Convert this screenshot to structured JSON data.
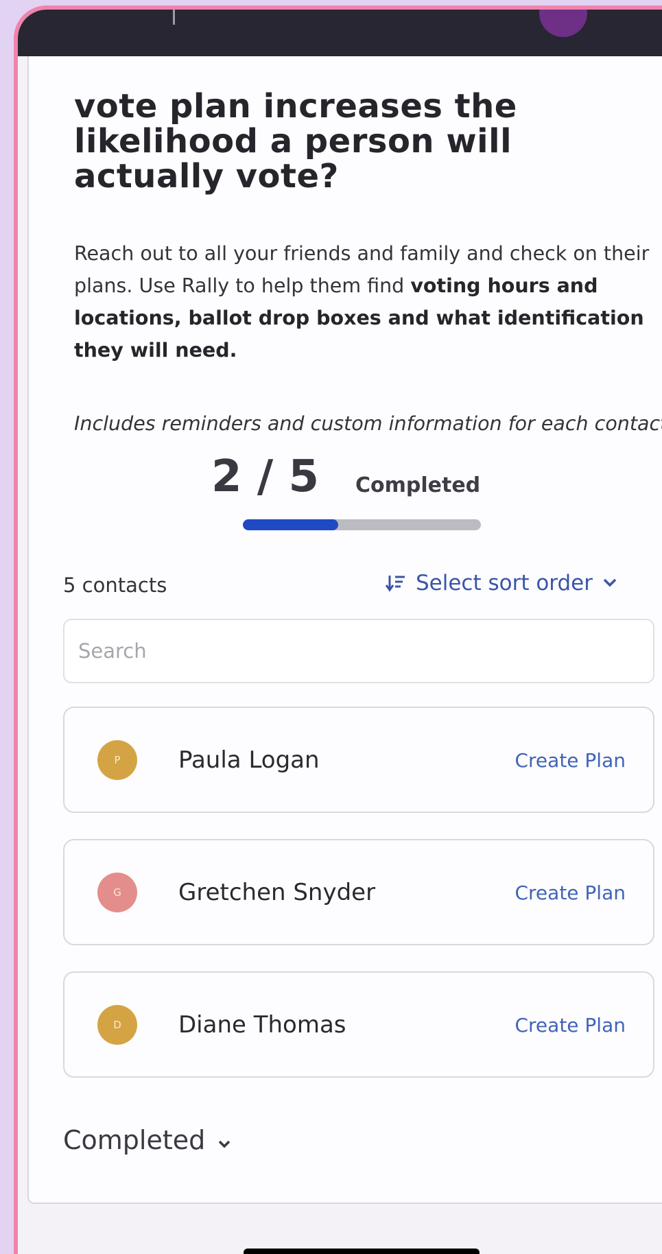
{
  "heading": {
    "line1": "vote plan increases the",
    "line2": "likelihood a person will",
    "line3": "actually vote?"
  },
  "intro": {
    "plain": "Reach out to all your friends and family and check on their plans. Use Rally to help them find ",
    "bold": "voting hours and locations, ballot drop boxes and what identification they will need."
  },
  "note": "Includes reminders and custom information for each contact!",
  "progress": {
    "count_text": "2 / 5",
    "label": "Completed",
    "completed": 2,
    "total": 5,
    "fraction": 0.4,
    "fill_color": "#2049c4"
  },
  "list": {
    "count_label": "5 contacts",
    "sort_label": "Select sort order",
    "sort_icon": "sort-descending-icon",
    "search_placeholder": "Search"
  },
  "contacts": [
    {
      "initial": "P",
      "name": "Paula Logan",
      "action": "Create Plan",
      "avatar_color": "#d4a444"
    },
    {
      "initial": "G",
      "name": "Gretchen Snyder",
      "action": "Create Plan",
      "avatar_color": "#e38e8c"
    },
    {
      "initial": "D",
      "name": "Diane Thomas",
      "action": "Create Plan",
      "avatar_color": "#d4a444"
    }
  ],
  "completed_section": {
    "label": "Completed"
  }
}
